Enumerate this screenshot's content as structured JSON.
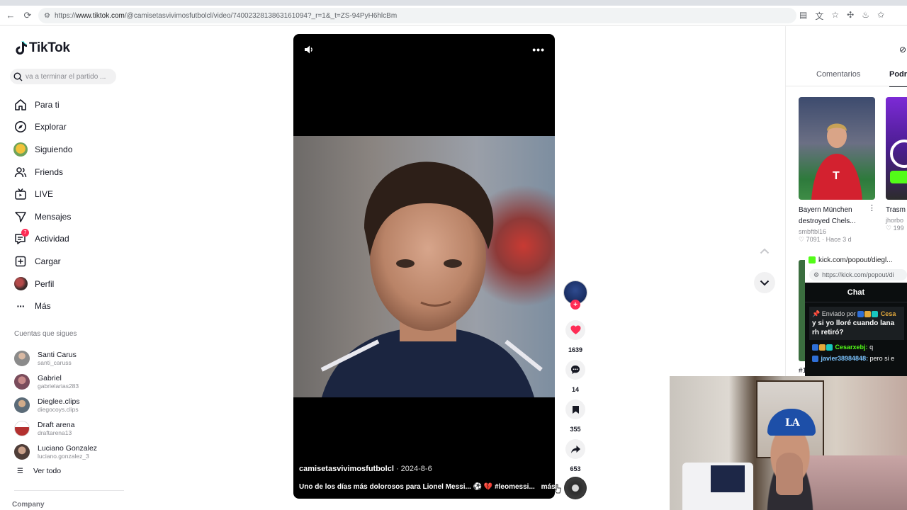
{
  "browser": {
    "url_prefix": "https://",
    "url_host": "www.tiktok.com",
    "url_path": "/@camisetasvivimosfutbolcl/video/7400232813863161094?_r=1&_t=ZS-94PyH6hlcBm"
  },
  "sidebar": {
    "logo_text": "TikTok",
    "search_placeholder": "va a terminar el partido ...",
    "nav": [
      {
        "label": "Para ti",
        "icon": "home-icon"
      },
      {
        "label": "Explorar",
        "icon": "compass-icon"
      },
      {
        "label": "Siguiendo",
        "icon": "following-avatar-icon"
      },
      {
        "label": "Friends",
        "icon": "friends-icon"
      },
      {
        "label": "LIVE",
        "icon": "live-tv-icon"
      },
      {
        "label": "Mensajes",
        "icon": "send-icon"
      },
      {
        "label": "Actividad",
        "icon": "activity-icon",
        "badge": "7"
      },
      {
        "label": "Cargar",
        "icon": "upload-icon"
      },
      {
        "label": "Perfil",
        "icon": "profile-avatar-icon"
      },
      {
        "label": "Más",
        "icon": "more-dots-icon"
      }
    ],
    "following_title": "Cuentas que sigues",
    "following": [
      {
        "name": "Santi Carus",
        "handle": "santi_caruss",
        "color": "#8b8b8b"
      },
      {
        "name": "Gabriel",
        "handle": "gabrielarias283",
        "color": "#a46b6b"
      },
      {
        "name": "Dieglee.clips",
        "handle": "diegocoys.clips",
        "color": "#6b7d8a"
      },
      {
        "name": "Draft arena",
        "handle": "draftarena13",
        "color": "#b3302f"
      },
      {
        "name": "Luciano Gonzalez",
        "handle": "luciano.gonzalez_3",
        "color": "#6e5a52"
      }
    ],
    "see_all": "Ver todo",
    "footer": "Company"
  },
  "video": {
    "author": "camisetasvivimosfutbolcl",
    "date": " · 2024-8-6",
    "description": "Uno de los días más dolorosos para Lionel Messi... ⚽ 💔 #leomessi...",
    "more_label": "más"
  },
  "actions": {
    "like_count": "1639",
    "comment_count": "14",
    "save_count": "355",
    "share_count": "653"
  },
  "right_panel": {
    "tab_comments": "Comentarios",
    "tab_more": "Podri",
    "recommendations": [
      {
        "title": "Bayern München destroyed Chels...",
        "author": "smbftbl16",
        "likes": "7091",
        "age": "· Hace 3 d"
      },
      {
        "title": "Trasm tiktok",
        "author": "jhorbo",
        "likes": "199",
        "age": ""
      }
    ],
    "hashtag_fragment": "#1"
  },
  "kick": {
    "window_title": "kick.com/popout/diegl...",
    "url": "https://kick.com/popout/di",
    "chat_title": "Chat",
    "pinned_prefix": "Enviado por",
    "pinned_user": "Cesa",
    "pinned_message": "y si yo lloré cuando lana rh retiró?",
    "messages": [
      {
        "user": "Cesarxebj:",
        "text": "q"
      },
      {
        "user": "javier38984848:",
        "text": "pero si e"
      }
    ]
  },
  "colors": {
    "accent": "#fe2c55",
    "kick_green": "#53fc18",
    "text": "#161823"
  }
}
